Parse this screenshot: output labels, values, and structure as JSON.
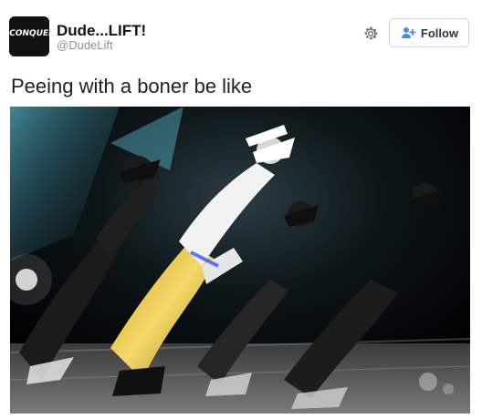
{
  "tweet": {
    "avatar_text": "CONQUER",
    "display_name": "Dude...LIFT!",
    "handle": "@DudeLift",
    "follow_label": "Follow",
    "text": "Peeing with a boner be like",
    "accent_color": "#4a90e2",
    "icons": {
      "settings": "gear-icon",
      "follow": "add-user-icon"
    }
  }
}
